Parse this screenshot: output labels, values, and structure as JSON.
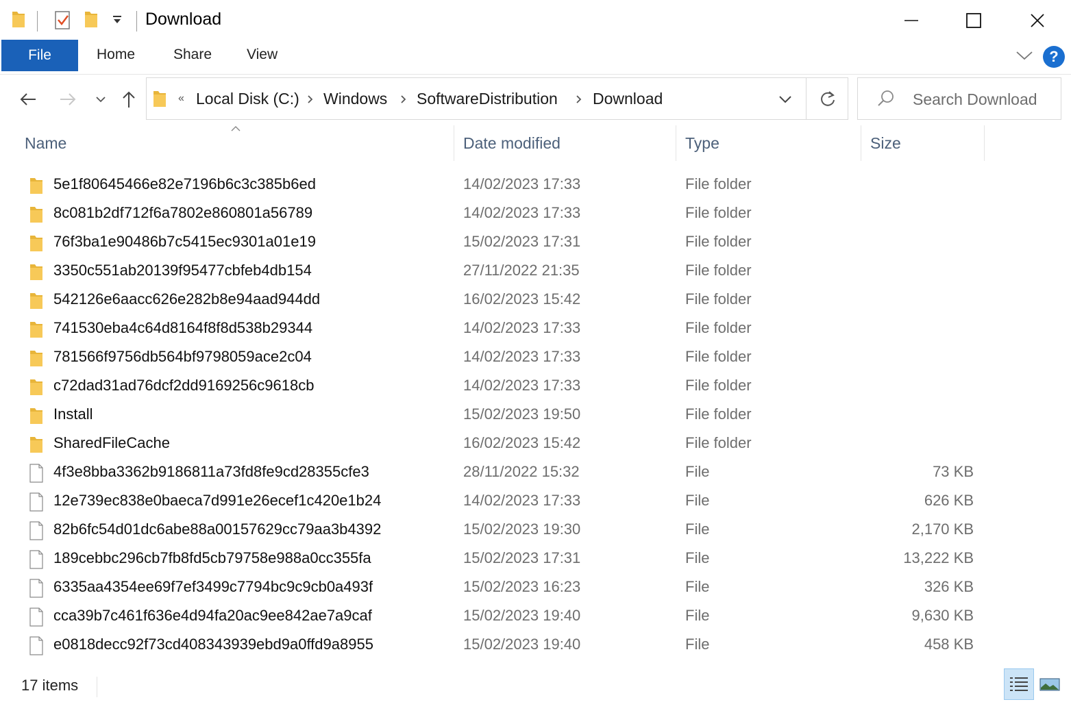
{
  "window": {
    "title": "Download"
  },
  "ribbon": {
    "tabs": [
      "File",
      "Home",
      "Share",
      "View"
    ],
    "help_label": "?"
  },
  "address": {
    "overflow": "«",
    "crumbs": [
      "Local Disk (C:)",
      "Windows",
      "SoftwareDistribution",
      "Download"
    ]
  },
  "search": {
    "placeholder": "Search Download"
  },
  "columns": {
    "name": "Name",
    "date": "Date modified",
    "type": "Type",
    "size": "Size"
  },
  "rows": [
    {
      "name": "5e1f80645466e82e7196b6c3c385b6ed",
      "date": "14/02/2023 17:33",
      "type": "File folder",
      "size": "",
      "icon": "folder-icon"
    },
    {
      "name": "8c081b2df712f6a7802e860801a56789",
      "date": "14/02/2023 17:33",
      "type": "File folder",
      "size": "",
      "icon": "folder-icon"
    },
    {
      "name": "76f3ba1e90486b7c5415ec9301a01e19",
      "date": "15/02/2023 17:31",
      "type": "File folder",
      "size": "",
      "icon": "folder-icon"
    },
    {
      "name": "3350c551ab20139f95477cbfeb4db154",
      "date": "27/11/2022 21:35",
      "type": "File folder",
      "size": "",
      "icon": "folder-icon"
    },
    {
      "name": "542126e6aacc626e282b8e94aad944dd",
      "date": "16/02/2023 15:42",
      "type": "File folder",
      "size": "",
      "icon": "folder-icon"
    },
    {
      "name": "741530eba4c64d8164f8f8d538b29344",
      "date": "14/02/2023 17:33",
      "type": "File folder",
      "size": "",
      "icon": "folder-icon"
    },
    {
      "name": "781566f9756db564bf9798059ace2c04",
      "date": "14/02/2023 17:33",
      "type": "File folder",
      "size": "",
      "icon": "folder-icon"
    },
    {
      "name": "c72dad31ad76dcf2dd9169256c9618cb",
      "date": "14/02/2023 17:33",
      "type": "File folder",
      "size": "",
      "icon": "folder-icon"
    },
    {
      "name": "Install",
      "date": "15/02/2023 19:50",
      "type": "File folder",
      "size": "",
      "icon": "folder-icon"
    },
    {
      "name": "SharedFileCache",
      "date": "16/02/2023 15:42",
      "type": "File folder",
      "size": "",
      "icon": "folder-icon"
    },
    {
      "name": "4f3e8bba3362b9186811a73fd8fe9cd28355cfe3",
      "date": "28/11/2022 15:32",
      "type": "File",
      "size": "73 KB",
      "icon": "file-icon"
    },
    {
      "name": "12e739ec838e0baeca7d991e26ecef1c420e1b24",
      "date": "14/02/2023 17:33",
      "type": "File",
      "size": "626 KB",
      "icon": "file-icon"
    },
    {
      "name": "82b6fc54d01dc6abe88a00157629cc79aa3b4392",
      "date": "15/02/2023 19:30",
      "type": "File",
      "size": "2,170 KB",
      "icon": "file-icon"
    },
    {
      "name": "189cebbc296cb7fb8fd5cb79758e988a0cc355fa",
      "date": "15/02/2023 17:31",
      "type": "File",
      "size": "13,222 KB",
      "icon": "file-icon"
    },
    {
      "name": "6335aa4354ee69f7ef3499c7794bc9c9cb0a493f",
      "date": "15/02/2023 16:23",
      "type": "File",
      "size": "326 KB",
      "icon": "file-icon"
    },
    {
      "name": "cca39b7c461f636e4d94fa20ac9ee842ae7a9caf",
      "date": "15/02/2023 19:40",
      "type": "File",
      "size": "9,630 KB",
      "icon": "file-icon"
    },
    {
      "name": "e0818decc92f73cd408343939ebd9a0ffd9a8955",
      "date": "15/02/2023 19:40",
      "type": "File",
      "size": "458 KB",
      "icon": "file-icon"
    }
  ],
  "status": {
    "item_count": "17 items"
  },
  "colors": {
    "accent": "#1a61b8",
    "folder": "#f7c958",
    "header_text": "#4c607a"
  }
}
